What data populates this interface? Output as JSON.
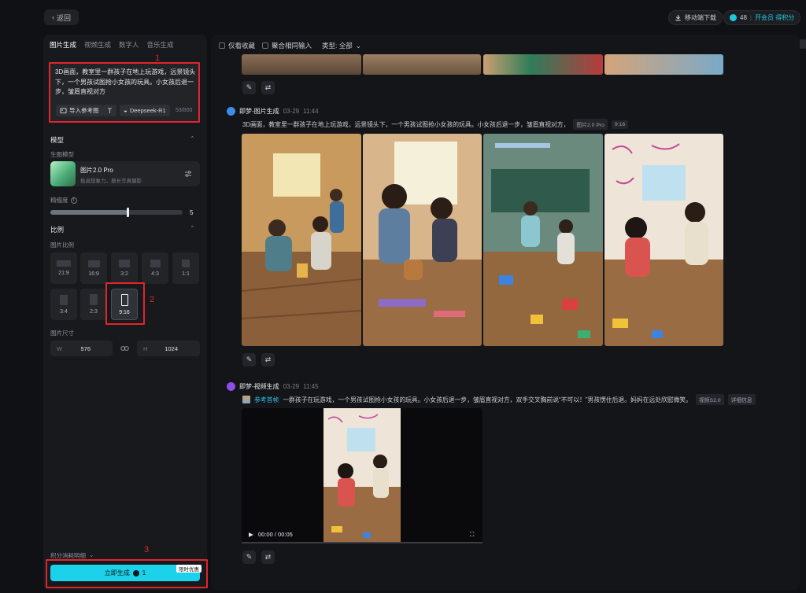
{
  "header": {
    "back_label": "返回",
    "download_label": "移动端下载",
    "points_value": "48",
    "vip_label": "开会员 得积分"
  },
  "sidebar": {
    "tabs": [
      {
        "label": "图片生成",
        "active": true
      },
      {
        "label": "视频生成",
        "active": false
      },
      {
        "label": "数字人",
        "active": false
      },
      {
        "label": "音乐生成",
        "active": false
      }
    ],
    "prompt": {
      "text": "3D画面，教室里一群孩子在地上玩游戏，远景镜头下，一个男孩试图抢小女孩的玩具。小女孩后退一步，皱眉直视对方",
      "import_ref_label": "导入参考图",
      "text_tool_icon": "text-format-icon",
      "deepseek_label": "Deepseek-R1",
      "char_count": "53/800"
    },
    "model_section": {
      "title": "模型",
      "gen_model_label": "生图模型",
      "model_name": "图片2.0 Pro",
      "model_desc": "极具想象力，擅长写真摄影"
    },
    "precision": {
      "label": "精细度",
      "value": "5",
      "level": 0.5
    },
    "ratio_section": {
      "title": "比例",
      "subtitle": "图片比例",
      "options": [
        "21:9",
        "16:9",
        "3:2",
        "4:3",
        "1:1",
        "3:4",
        "2:3",
        "9:16"
      ],
      "selected": "9:16"
    },
    "size": {
      "label": "图片尺寸",
      "w_label": "W",
      "w_value": "576",
      "h_label": "H",
      "h_value": "1024"
    },
    "points_detail_label": "积分消耗明细",
    "generate": {
      "label": "立即生成",
      "cost": "1",
      "badge": "限时优惠"
    },
    "annotations": {
      "n1": "1",
      "n2": "2",
      "n3": "3"
    }
  },
  "main": {
    "filters": {
      "favorites_label": "仅看收藏",
      "aggregate_label": "聚合相同输入",
      "type_label": "类型: 全部"
    },
    "feed": [
      {
        "author": "即梦-图片生成",
        "date": "03-29",
        "time": "11:44",
        "caption": "3D画面，教室里一群孩子在地上玩游戏，远景镜头下，一个男孩试图抢小女孩的玩具。小女孩后退一步，皱眉直视对方，",
        "tags": [
          "图片2.0 Pro",
          "9:16"
        ]
      },
      {
        "author": "即梦-视频生成",
        "date": "03-29",
        "time": "11:45",
        "ref_label": "参考首帧",
        "caption": "一群孩子在玩游戏，一个男孩试图抢小女孩的玩具。小女孩后退一步，皱眉直视对方，双手交叉胸前说“不可以！”男孩愣住后退。妈妈在远处欣慰微笑。",
        "tags": [
          "视频S2.0",
          "详细信息"
        ],
        "video_time": "00:00 / 00:05"
      }
    ]
  },
  "colors": {
    "accent": "#1cd2ea",
    "annotation": "#e0262a",
    "panel": "#18191d"
  }
}
